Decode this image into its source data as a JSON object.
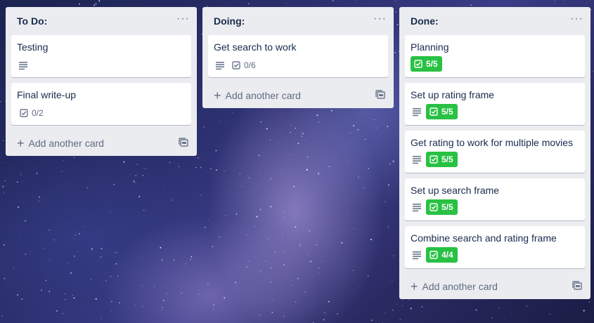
{
  "board": {
    "add_card_label": "Add another card",
    "lists": [
      {
        "title": "To Do:",
        "cards": [
          {
            "title": "Testing",
            "has_description": true,
            "checklist": null
          },
          {
            "title": "Final write-up",
            "has_description": false,
            "checklist": {
              "text": "0/2",
              "complete": false
            }
          }
        ]
      },
      {
        "title": "Doing:",
        "cards": [
          {
            "title": "Get search to work",
            "has_description": true,
            "checklist": {
              "text": "0/6",
              "complete": false
            }
          }
        ]
      },
      {
        "title": "Done:",
        "cards": [
          {
            "title": "Planning",
            "has_description": false,
            "checklist": {
              "text": "5/5",
              "complete": true
            }
          },
          {
            "title": "Set up rating frame",
            "has_description": true,
            "checklist": {
              "text": "5/5",
              "complete": true
            }
          },
          {
            "title": "Get rating to work for multiple movies",
            "has_description": true,
            "checklist": {
              "text": "5/5",
              "complete": true
            }
          },
          {
            "title": "Set up search frame",
            "has_description": true,
            "checklist": {
              "text": "5/5",
              "complete": true
            }
          },
          {
            "title": "Combine search and rating frame",
            "has_description": true,
            "checklist": {
              "text": "4/4",
              "complete": true
            }
          }
        ]
      }
    ]
  },
  "colors": {
    "list_bg": "#ebecf0",
    "complete_badge": "#28c144",
    "text": "#172b4d",
    "muted": "#5e6c84"
  },
  "icons": {
    "description": "description-icon",
    "checklist": "checklist-icon",
    "menu": "ellipsis-icon",
    "plus": "plus-icon",
    "template": "card-template-icon"
  }
}
